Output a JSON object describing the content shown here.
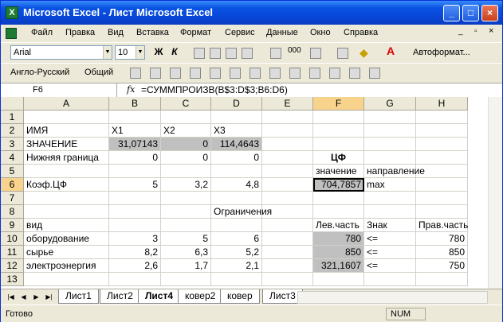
{
  "window": {
    "title": "Microsoft Excel - Лист Microsoft Excel",
    "app_icon": "excel-icon"
  },
  "menu": [
    "Файл",
    "Правка",
    "Вид",
    "Вставка",
    "Формат",
    "Сервис",
    "Данные",
    "Окно",
    "Справка"
  ],
  "toolbar": {
    "font": "Arial",
    "size": "10",
    "autoformat": "Автоформат...",
    "language": "Англо-Русский",
    "general": "Общий"
  },
  "formula_bar": {
    "name_box": "F6",
    "fx": "fx",
    "formula": "=СУММПРОИЗВ(B$3:D$3;B6:D6)"
  },
  "columns": [
    "A",
    "B",
    "C",
    "D",
    "E",
    "F",
    "G",
    "H"
  ],
  "rows": [
    "1",
    "2",
    "3",
    "4",
    "5",
    "6",
    "7",
    "8",
    "9",
    "10",
    "11",
    "12",
    "13"
  ],
  "cells": {
    "A2": "ИМЯ",
    "B2": "X1",
    "C2": "X2",
    "D2": "X3",
    "A3": "ЗНАЧЕНИЕ",
    "B3": "31,07143",
    "C3": "0",
    "D3": "114,4643",
    "A4": "Нижняя граница",
    "B4": "0",
    "C4": "0",
    "D4": "0",
    "F4": "ЦФ",
    "F5": "значение",
    "G5": "направление",
    "A6": "Коэф.ЦФ",
    "B6": "5",
    "C6": "3,2",
    "D6": "4,8",
    "F6": "704,7857",
    "G6": "max",
    "D8": "Ограничения",
    "A9": "вид",
    "F9": "Лев.часть",
    "G9": "Знак",
    "H9": "Прав.часть",
    "A10": "оборудование",
    "B10": "3",
    "C10": "5",
    "D10": "6",
    "F10": "780",
    "G10": "<=",
    "H10": "780",
    "A11": "сырье",
    "B11": "8,2",
    "C11": "6,3",
    "D11": "5,2",
    "F11": "850",
    "G11": "<=",
    "H11": "850",
    "A12": "электроэнергия",
    "B12": "2,6",
    "C12": "1,7",
    "D12": "2,1",
    "F12": "321,1607",
    "G12": "<=",
    "H12": "750"
  },
  "sheets": [
    "Лист1",
    "Лист2",
    "Лист4",
    "ковер2",
    "ковер",
    "Лист3"
  ],
  "active_sheet": "Лист4",
  "status": {
    "ready": "Готово",
    "num": "NUM"
  }
}
